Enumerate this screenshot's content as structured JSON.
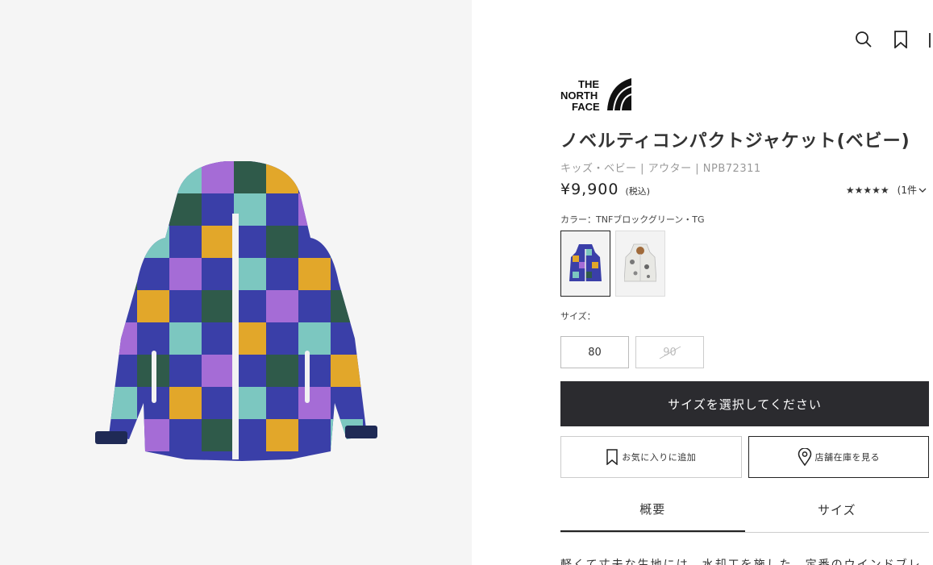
{
  "product": {
    "title": "ノベルティコンパクトジャケット(ベビー)",
    "category": "キッズ・ベビー | アウター | NPB72311",
    "price": "¥9,900",
    "tax_note": "(税込)",
    "rating_stars": "★★★★★",
    "review_count": "(1件",
    "color_label": "カラー：TNFブロックグリーン・TG",
    "size_label": "サイズ：",
    "sizes": [
      {
        "label": "80",
        "available": true
      },
      {
        "label": "90",
        "available": false
      }
    ],
    "select_size_button": "サイズを選択してください",
    "favorite_button": "お気に入りに追加",
    "store_stock_button": "店舗在庫を見る",
    "description_preview": "軽くて丈夫な生地には、水却工を施した、定番のウインドブレ"
  },
  "tabs": [
    {
      "label": "概要",
      "active": true
    },
    {
      "label": "サイズ",
      "active": false
    }
  ],
  "brand": {
    "logo_text_line1": "THE",
    "logo_text_line2": "NORTH",
    "logo_text_line3": "FACE"
  },
  "icons": {
    "search": "search-icon",
    "bookmark": "bookmark-icon",
    "favorite": "bookmark-icon",
    "store": "location-pin-icon"
  },
  "colors": {
    "primary_button": "#2b2b2f",
    "background_left": "#f5f5f5"
  }
}
